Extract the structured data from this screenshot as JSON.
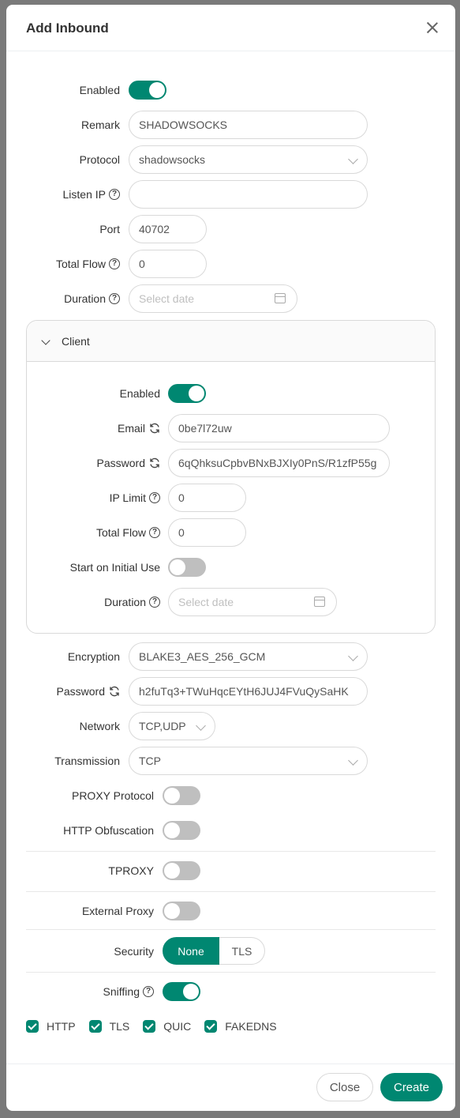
{
  "modal": {
    "title": "Add Inbound"
  },
  "form": {
    "enabled_label": "Enabled",
    "remark_label": "Remark",
    "remark_value": "SHADOWSOCKS",
    "protocol_label": "Protocol",
    "protocol_value": "shadowsocks",
    "listen_ip_label": "Listen IP",
    "listen_ip_value": "",
    "port_label": "Port",
    "port_value": "40702",
    "total_flow_label": "Total Flow",
    "total_flow_value": "0",
    "duration_label": "Duration",
    "duration_placeholder": "Select date"
  },
  "client": {
    "panel_title": "Client",
    "enabled_label": "Enabled",
    "email_label": "Email",
    "email_value": "0be7l72uw",
    "password_label": "Password",
    "password_value": "6qQhksuCpbvBNxBJXIy0PnS/R1zfP55g",
    "ip_limit_label": "IP Limit",
    "ip_limit_value": "0",
    "total_flow_label": "Total Flow",
    "total_flow_value": "0",
    "start_initial_label": "Start on Initial Use",
    "duration_label": "Duration",
    "duration_placeholder": "Select date"
  },
  "settings": {
    "encryption_label": "Encryption",
    "encryption_value": "BLAKE3_AES_256_GCM",
    "password_label": "Password",
    "password_value": "h2fuTq3+TWuHqcEYtH6JUJ4FVuQySaHK",
    "network_label": "Network",
    "network_value": "TCP,UDP",
    "transmission_label": "Transmission",
    "transmission_value": "TCP",
    "proxy_protocol_label": "PROXY Protocol",
    "http_obfuscation_label": "HTTP Obfuscation",
    "tproxy_label": "TPROXY",
    "external_proxy_label": "External Proxy",
    "security_label": "Security",
    "security_options": [
      "None",
      "TLS"
    ],
    "sniffing_label": "Sniffing",
    "sniffing_options": [
      "HTTP",
      "TLS",
      "QUIC",
      "FAKEDNS"
    ]
  },
  "footer": {
    "close_label": "Close",
    "create_label": "Create"
  },
  "colors": {
    "accent": "#008771",
    "toggle_off": "#bfbfbf"
  }
}
